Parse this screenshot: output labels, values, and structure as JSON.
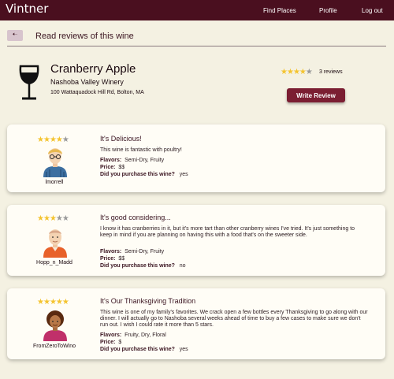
{
  "app": {
    "brand": "Vintner"
  },
  "nav": {
    "find_places": "Find Places",
    "profile": "Profile",
    "logout": "Log out"
  },
  "header": {
    "back_icon": "arrow-left-icon",
    "page_label": "Read reviews of this wine"
  },
  "wine": {
    "name": "Cranberry Apple",
    "winery": "Nashoba Valley Winery",
    "address": "100 Wattaquadock Hill Rd, Bolton, MA",
    "average_rating": 4,
    "max_rating": 5,
    "reviews_count_text": "3 reviews",
    "write_review_label": "Write Review"
  },
  "labels": {
    "flavors": "Flavors:",
    "price": "Price:",
    "purchased": "Did you purchase this wine?"
  },
  "reviews": [
    {
      "username": "lmorrell",
      "rating": 4,
      "title": "It's Delicious!",
      "body": "This wine is fantastic with poultry!",
      "flavors": "Semi-Dry, Fruity",
      "price": "$$",
      "purchased": "yes"
    },
    {
      "username": "Hopp_n_Madd",
      "rating": 3,
      "title": "It's good considering...",
      "body": "I know it has cranberries in it, but it's more tart than other cranberry wines I've tried. It's just something to keep in mind if you are planning on having this with a food that's on the sweeter side.",
      "flavors": "Semi-Dry, Fruity",
      "price": "$$",
      "purchased": "no"
    },
    {
      "username": "FromZeroToWino",
      "rating": 5,
      "title": "It's Our Thanksgiving Tradition",
      "body": "This wine is one of my family's favorites. We crack open a few bottles every Thanksgiving to go along with our dinner. I will actually go to Nashoba several weeks ahead of time to buy a few cases to make sure we don't run out. I wish I could rate it more than 5 stars.",
      "flavors": "Fruity, Dry, Floral",
      "price": "$",
      "purchased": "yes"
    }
  ],
  "colors": {
    "topbar": "#4a0f1f",
    "accent": "#7b1e32",
    "background": "#f4f1e2",
    "star": "#f4c430"
  }
}
